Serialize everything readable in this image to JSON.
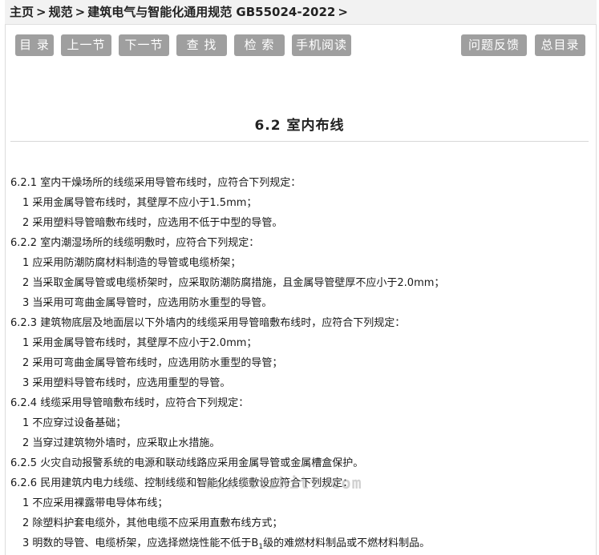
{
  "breadcrumb": {
    "home": "主页",
    "sep": ">",
    "section": "规范",
    "current": "建筑电气与智能化通用规范 GB55024-2022"
  },
  "toolbar": {
    "buttons": [
      "目 录",
      "上一节",
      "下一节",
      "查 找",
      "检 索",
      "手机阅读",
      "问题反馈",
      "总目录"
    ]
  },
  "page_title": "6.2 室内布线",
  "lines": [
    "6.2.1 室内干燥场所的线缆采用导管布线时，应符合下列规定：",
    "1 采用金属导管布线时，其壁厚不应小于1.5mm；",
    "2 采用塑料导管暗敷布线时，应选用不低于中型的导管。",
    "6.2.2 室内潮湿场所的线缆明敷时，应符合下列规定：",
    "1 应采用防潮防腐材料制造的导管或电缆桥架；",
    "2 当采取金属导管或电缆桥架时，应采取防潮防腐措施，且金属导管壁厚不应小于2.0mm；",
    "3 当采用可弯曲金属导管时，应选用防水重型的导管。",
    "6.2.3 建筑物底层及地面层以下外墙内的线缆采用导管暗敷布线时，应符合下列规定：",
    "1 采用金属导管布线时，其壁厚不应小于2.0mm；",
    "2 采用可弯曲金属导管布线时，应选用防水重型的导管；",
    "3 采用塑料导管布线时，应选用重型的导管。",
    "6.2.4 线缆采用导管暗敷布线时，应符合下列规定：",
    "1 不应穿过设备基础；",
    "2 当穿过建筑物外墙时，应采取止水措施。",
    "6.2.5 火灾自动报警系统的电源和联动线路应采用金属导管或金属槽盒保护。",
    "6.2.6 民用建筑内电力线缆、控制线缆和智能化线缆敷设应符合下列规定：",
    "1 不应采用裸露带电导体布线；",
    "2 除塑料护套电缆外，其他电缆不应采用直敷布线方式；"
  ],
  "last_line": {
    "before": "3 明数的导管、电缆桥架，应选择燃烧性能不低于B",
    "sub": "1",
    "after": "级的难燃材料制品或不燃材料制品。"
  },
  "watermark": "www.ttzhitt.com"
}
